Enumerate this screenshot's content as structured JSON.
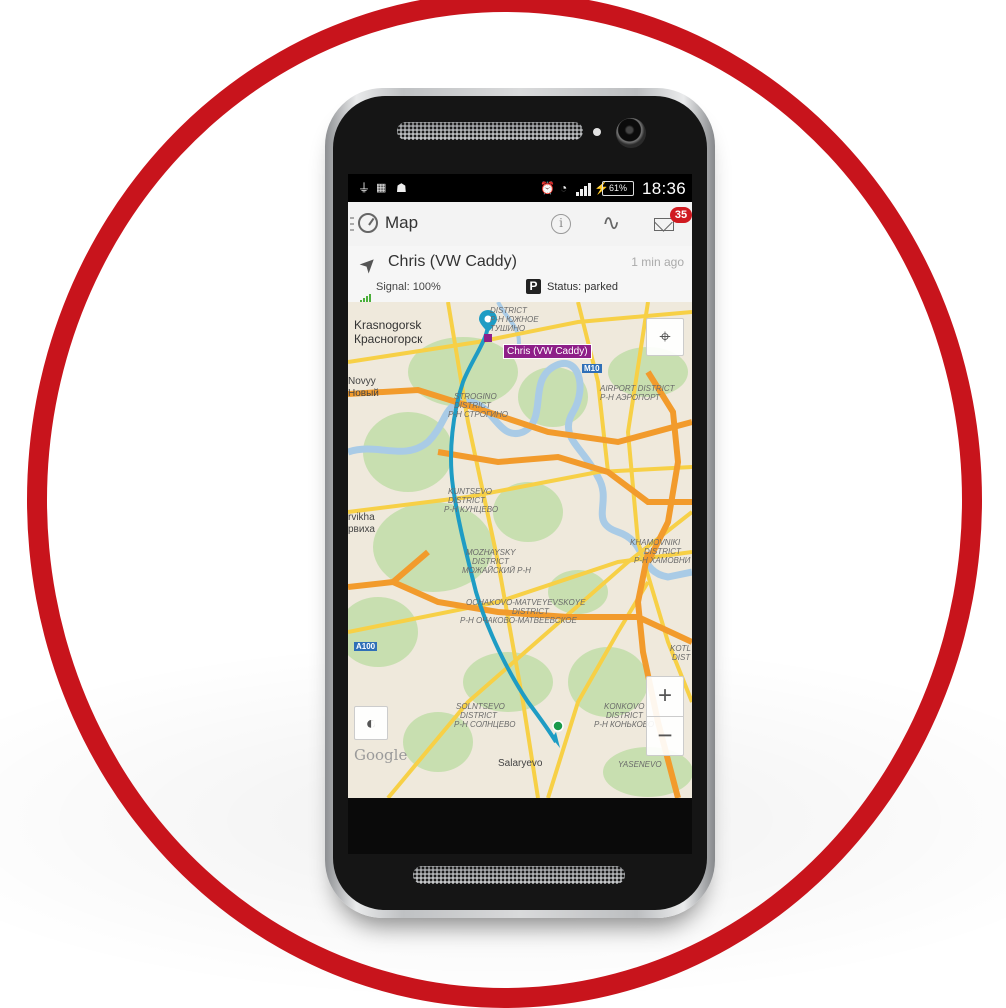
{
  "status_bar": {
    "usb_icon": "usb-icon",
    "image_icon": "image-icon",
    "android_icon": "android-icon",
    "battery": "61%",
    "time": "18:36"
  },
  "app_bar": {
    "title": "Map",
    "badge_count": "35"
  },
  "vehicle": {
    "name": "Chris (VW Caddy)",
    "last_update": "1 min ago",
    "signal": "Signal: 100%",
    "status_icon": "P",
    "status": "Status: parked"
  },
  "map": {
    "marker_label": "Chris (VW Caddy)",
    "labels": {
      "krasnogorsk": "Krasnogorsk",
      "krasnogorsk_ru": "Красногорск",
      "novyy": "Novyy",
      "novyy_ru": "Новый",
      "rvikha": "rvikha",
      "rvikha_ru": "рвиха",
      "district_top_1": "DISTRICT",
      "district_top_2": "Р-Н ЮЖНОЕ",
      "district_top_3": "ТУШИНО",
      "airport_1": "AIRPORT DISTRICT",
      "airport_2": "Р-Н АЭРОПОРТ",
      "strogino_1": "STROGINO",
      "strogino_2": "DISTRICT",
      "strogino_3": "Р-Н СТРОГИНО",
      "kuntsevo_1": "KUNTSEVO",
      "kuntsevo_2": "DISTRICT",
      "kuntsevo_3": "Р-Н КУНЦЕВО",
      "mozhaysky_1": "MOZHAYSKY",
      "mozhaysky_2": "DISTRICT",
      "mozhaysky_3": "МОЖАЙСКИЙ Р-Н",
      "khamovniki_1": "KHAMOVNIKI",
      "khamovniki_2": "DISTRICT",
      "khamovniki_3": "Р-Н ХАМОВНИ",
      "ochakovo_1": "OCHAKOVO-MATVEYEVSKOYE",
      "ochakovo_2": "DISTRICT",
      "ochakovo_3": "Р-Н ОЧАКОВО-МАТВЕЕВСКОЕ",
      "solntsevo_1": "SOLNTSEVO",
      "solntsevo_2": "DISTRICT",
      "solntsevo_3": "Р-Н СОЛНЦЕВО",
      "konkovo_1": "KONKOVO",
      "konkovo_2": "DISTRICT",
      "konkovo_3": "Р-Н КОНЬКОВО",
      "kotl_1": "KOTL",
      "kotl_2": "DIST",
      "yasenevo": "YASENEVO",
      "salaryevo": "Salaryevo"
    },
    "shields": {
      "m10": "M10",
      "a100": "A100"
    },
    "zoom_in": "+",
    "zoom_out": "−",
    "attribution": "Google"
  },
  "colors": {
    "ring": "#c8141c",
    "route": "#1e9cc4",
    "highway": "#f29b2c",
    "road": "#f7d046",
    "park": "#c8dfb0",
    "water": "#a9cbe6",
    "badge": "#d01a20",
    "vehicle_tag": "#8e1f88"
  }
}
